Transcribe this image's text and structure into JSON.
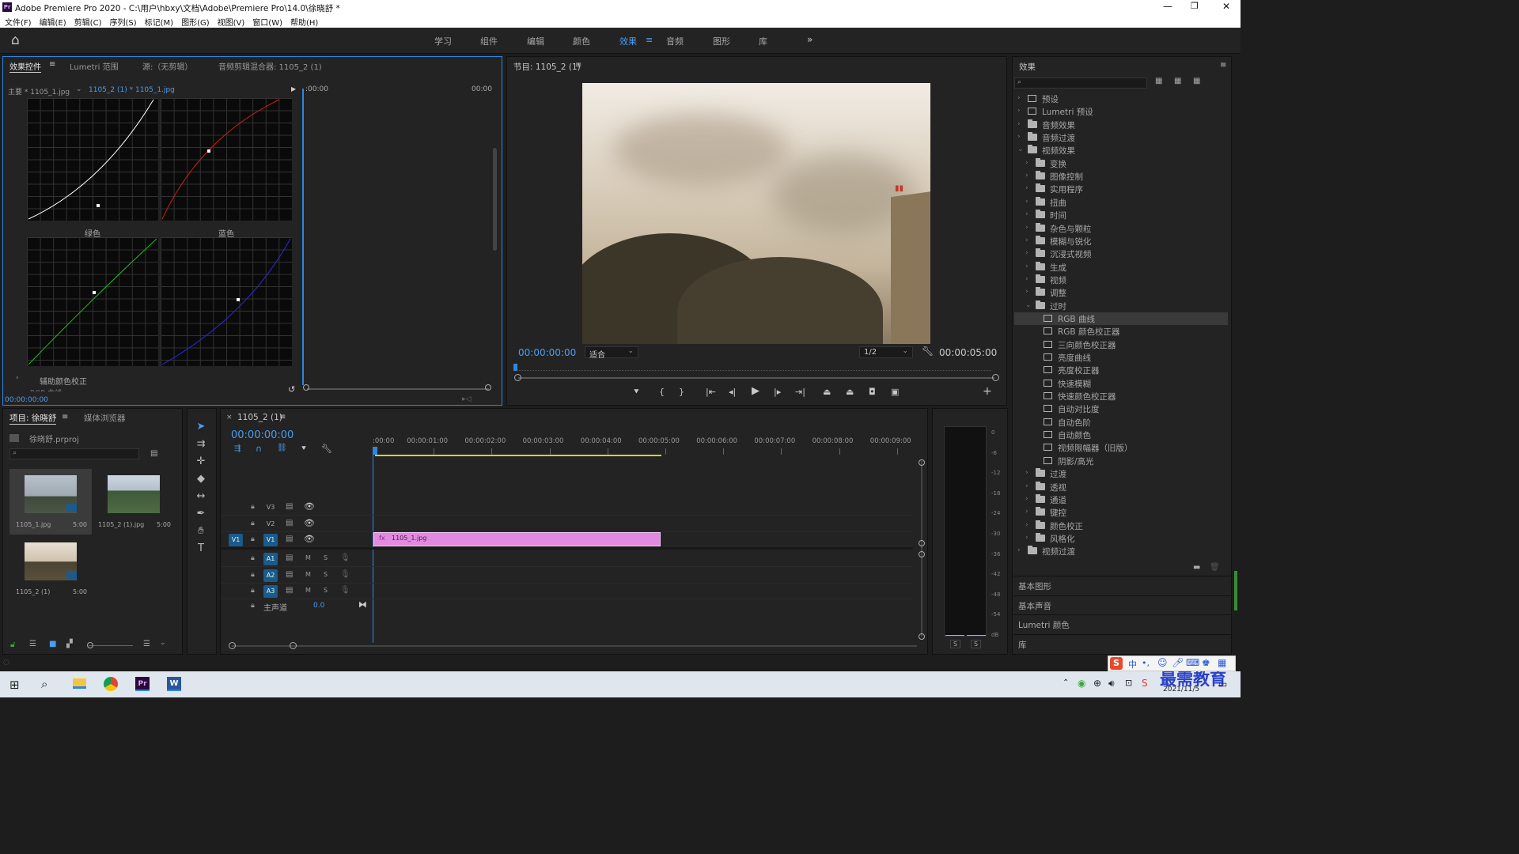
{
  "window": {
    "title": "Adobe Premiere Pro 2020 - C:\\用户\\hbxy\\文档\\Adobe\\Premiere Pro\\14.0\\徐晓舒 *",
    "app_icon": "Pr"
  },
  "menu": [
    "文件(F)",
    "编辑(E)",
    "剪辑(C)",
    "序列(S)",
    "标记(M)",
    "图形(G)",
    "视图(V)",
    "窗口(W)",
    "帮助(H)"
  ],
  "workspaces": [
    "学习",
    "组件",
    "编辑",
    "颜色",
    "效果",
    "音频",
    "图形",
    "库"
  ],
  "active_workspace": "效果",
  "effect_controls": {
    "tabs": [
      "效果控件",
      "Lumetri 范围",
      "源:（无剪辑）",
      "音频剪辑混合器: 1105_2 (1)"
    ],
    "master_label": "主要 * 1105_1.jpg",
    "clip_label": "1105_2 (1) * 1105_1.jpg",
    "time_start": ":00:00",
    "time_end": "00:00",
    "green_label": "绿色",
    "blue_label": "蓝色",
    "aux_label": "辅助颜色校正",
    "rgb_curves_label": "RGB 曲线",
    "timecode": "00:00:00:00"
  },
  "program_monitor": {
    "title": "节目: 1105_2 (1)",
    "timecode_current": "00:00:00:00",
    "fit": "适合",
    "resolution": "1/2",
    "timecode_duration": "00:00:05:00"
  },
  "project": {
    "tabs": [
      "项目: 徐晓舒",
      "媒体浏览器"
    ],
    "project_file": "徐晓舒.prproj",
    "items": [
      {
        "name": "1105_1.jpg",
        "duration": "5:00"
      },
      {
        "name": "1105_2 (1).jpg",
        "duration": "5:00"
      },
      {
        "name": "1105_2 (1)",
        "duration": "5:00"
      }
    ]
  },
  "timeline": {
    "tab": "1105_2 (1)",
    "timecode": "00:00:00:00",
    "ruler": [
      ":00:00",
      "00:00:01:00",
      "00:00:02:00",
      "00:00:03:00",
      "00:00:04:00",
      "00:00:05:00",
      "00:00:06:00",
      "00:00:07:00",
      "00:00:08:00",
      "00:00:09:00"
    ],
    "video_tracks": [
      "V3",
      "V2",
      "V1"
    ],
    "audio_tracks": [
      "A1",
      "A2",
      "A3"
    ],
    "source_patch": "V1",
    "master_label": "主声道",
    "master_value": "0.0",
    "clip_name": "1105_1.jpg",
    "mute_label": "M",
    "solo_label": "S"
  },
  "audio_meter": {
    "scale": [
      "0",
      "-6",
      "-12",
      "-18",
      "-24",
      "-30",
      "-36",
      "-42",
      "-48",
      "-54",
      "dB"
    ],
    "buttons": [
      "S",
      "S"
    ]
  },
  "effects": {
    "title": "效果",
    "tree": [
      {
        "label": "预设",
        "level": 0,
        "type": "preset",
        "open": false
      },
      {
        "label": "Lumetri 预设",
        "level": 0,
        "type": "preset",
        "open": false
      },
      {
        "label": "音频效果",
        "level": 0,
        "type": "folder",
        "open": false
      },
      {
        "label": "音频过渡",
        "level": 0,
        "type": "folder",
        "open": false
      },
      {
        "label": "视频效果",
        "level": 0,
        "type": "folder",
        "open": true
      },
      {
        "label": "变换",
        "level": 1,
        "type": "folder",
        "open": false
      },
      {
        "label": "图像控制",
        "level": 1,
        "type": "folder",
        "open": false
      },
      {
        "label": "实用程序",
        "level": 1,
        "type": "folder",
        "open": false
      },
      {
        "label": "扭曲",
        "level": 1,
        "type": "folder",
        "open": false
      },
      {
        "label": "时间",
        "level": 1,
        "type": "folder",
        "open": false
      },
      {
        "label": "杂色与颗粒",
        "level": 1,
        "type": "folder",
        "open": false
      },
      {
        "label": "模糊与锐化",
        "level": 1,
        "type": "folder",
        "open": false
      },
      {
        "label": "沉浸式视频",
        "level": 1,
        "type": "folder",
        "open": false
      },
      {
        "label": "生成",
        "level": 1,
        "type": "folder",
        "open": false
      },
      {
        "label": "视频",
        "level": 1,
        "type": "folder",
        "open": false
      },
      {
        "label": "调整",
        "level": 1,
        "type": "folder",
        "open": false
      },
      {
        "label": "过时",
        "level": 1,
        "type": "folder",
        "open": true
      },
      {
        "label": "RGB 曲线",
        "level": 2,
        "type": "preset",
        "selected": true
      },
      {
        "label": "RGB 颜色校正器",
        "level": 2,
        "type": "preset"
      },
      {
        "label": "三向颜色校正器",
        "level": 2,
        "type": "preset"
      },
      {
        "label": "亮度曲线",
        "level": 2,
        "type": "preset"
      },
      {
        "label": "亮度校正器",
        "level": 2,
        "type": "preset"
      },
      {
        "label": "快速模糊",
        "level": 2,
        "type": "preset"
      },
      {
        "label": "快速颜色校正器",
        "level": 2,
        "type": "preset"
      },
      {
        "label": "自动对比度",
        "level": 2,
        "type": "preset"
      },
      {
        "label": "自动色阶",
        "level": 2,
        "type": "preset"
      },
      {
        "label": "自动颜色",
        "level": 2,
        "type": "preset"
      },
      {
        "label": "视频限幅器（旧版）",
        "level": 2,
        "type": "preset"
      },
      {
        "label": "阴影/高光",
        "level": 2,
        "type": "preset"
      },
      {
        "label": "过渡",
        "level": 1,
        "type": "folder",
        "open": false
      },
      {
        "label": "透视",
        "level": 1,
        "type": "folder",
        "open": false
      },
      {
        "label": "通道",
        "level": 1,
        "type": "folder",
        "open": false
      },
      {
        "label": "键控",
        "level": 1,
        "type": "folder",
        "open": false
      },
      {
        "label": "颜色校正",
        "level": 1,
        "type": "folder",
        "open": false
      },
      {
        "label": "风格化",
        "level": 1,
        "type": "folder",
        "open": false
      },
      {
        "label": "视频过渡",
        "level": 0,
        "type": "folder",
        "open": false
      }
    ],
    "sections": [
      "基本图形",
      "基本声音",
      "Lumetri 颜色",
      "库"
    ]
  },
  "taskbar": {
    "date": "2021/11/5",
    "watermark": "最需教育",
    "ime_label": "中"
  },
  "colors": {
    "accent": "#2e86de",
    "clip": "#e28ae0",
    "timecode": "#4a9df0",
    "curve_white": "#ffffff",
    "curve_red": "#d11a1a",
    "curve_green": "#19c219",
    "curve_blue": "#2b2bd8"
  }
}
